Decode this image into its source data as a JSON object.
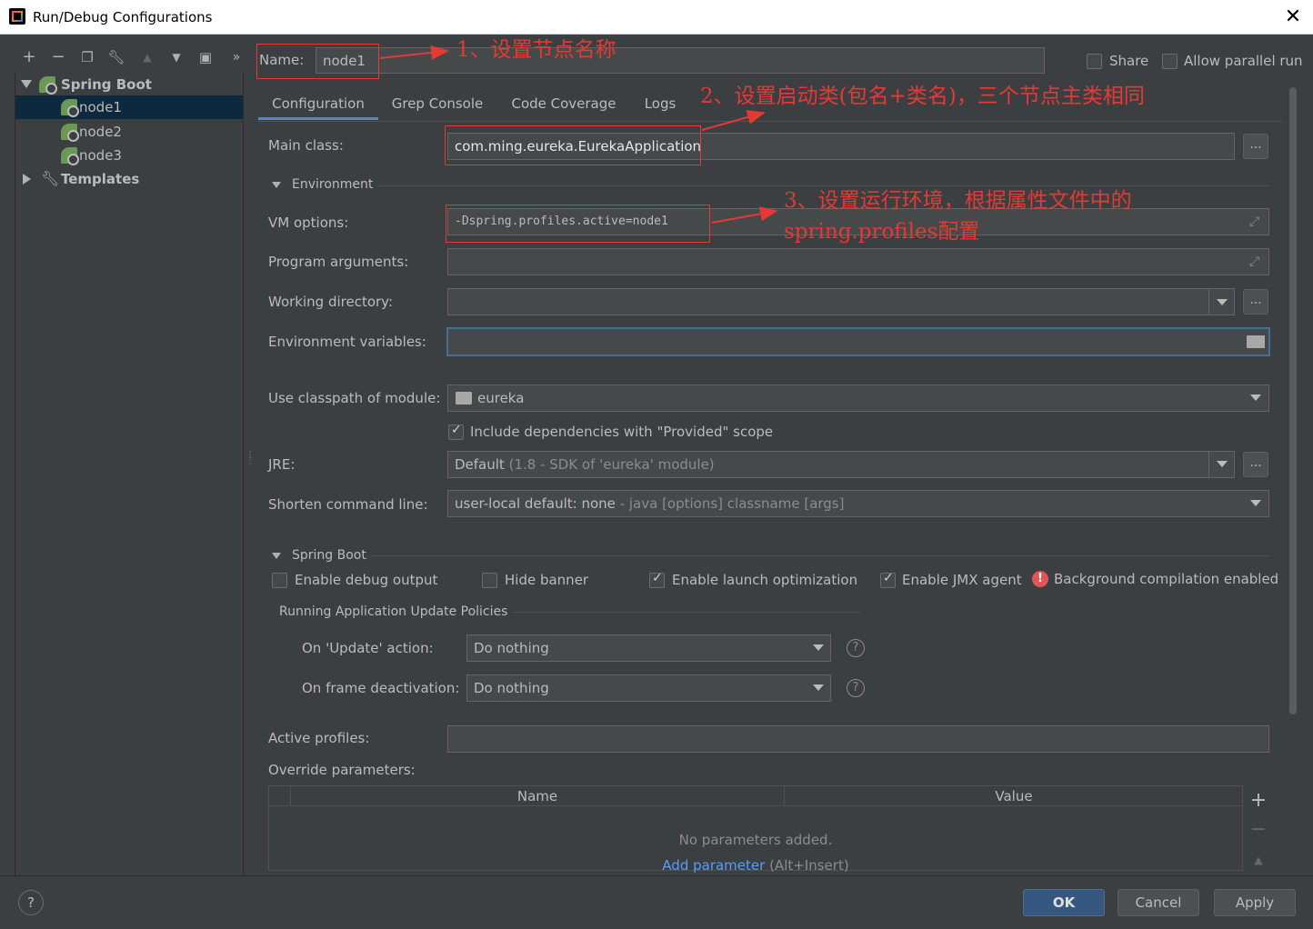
{
  "window": {
    "title": "Run/Debug Configurations"
  },
  "left_panel": {
    "tree": {
      "group_label": "Spring Boot",
      "items": [
        "node1",
        "node2",
        "node3"
      ],
      "templates_label": "Templates"
    }
  },
  "header": {
    "name_label": "Name:",
    "name_value": "node1",
    "share_label": "Share",
    "parallel_label": "Allow parallel run"
  },
  "tabs": [
    "Configuration",
    "Grep Console",
    "Code Coverage",
    "Logs"
  ],
  "form": {
    "main_class_label": "Main class:",
    "main_class_value": "com.ming.eureka.EurekaApplication",
    "environment_section": "Environment",
    "vm_options_label": "VM options:",
    "vm_options_value": "-Dspring.profiles.active=node1",
    "program_args_label": "Program arguments:",
    "working_dir_label": "Working directory:",
    "env_vars_label": "Environment variables:",
    "classpath_label": "Use classpath of module:",
    "classpath_value": "eureka",
    "include_deps_label": "Include dependencies with \"Provided\" scope",
    "jre_label": "JRE:",
    "jre_value": "Default",
    "jre_hint": "(1.8 - SDK of 'eureka' module)",
    "shorten_label": "Shorten command line:",
    "shorten_value": "user-local default: none",
    "shorten_hint": "- java [options] classname [args]"
  },
  "spring_boot": {
    "section": "Spring Boot",
    "debug_output_label": "Enable debug output",
    "hide_banner_label": "Hide banner",
    "launch_opt_label": "Enable launch optimization",
    "jmx_label": "Enable JMX agent",
    "bg_compile_label": "Background compilation enabled",
    "policies_section": "Running Application Update Policies",
    "on_update_label": "On 'Update' action:",
    "on_update_value": "Do nothing",
    "on_frame_label": "On frame deactivation:",
    "on_frame_value": "Do nothing",
    "active_profiles_label": "Active profiles:",
    "override_label": "Override parameters:",
    "table_headers": [
      "Name",
      "Value"
    ],
    "no_params_text": "No parameters added.",
    "add_param_link": "Add parameter",
    "add_param_hint": "(Alt+Insert)"
  },
  "annotations": {
    "a1": "1、设置节点名称",
    "a2": "2、设置启动类(包名+类名)，三个节点主类相同",
    "a3_line1": "3、设置运行环境，根据属性文件中的",
    "a3_line2": "spring.profiles配置"
  },
  "footer": {
    "ok_label": "OK",
    "cancel_label": "Cancel",
    "apply_label": "Apply",
    "help_label": "?"
  },
  "colors": {
    "background": "#3c3f41",
    "selection": "#0d293e",
    "accent": "#4a88c7",
    "annotation_red": "#e53935",
    "primary_button": "#365880"
  }
}
